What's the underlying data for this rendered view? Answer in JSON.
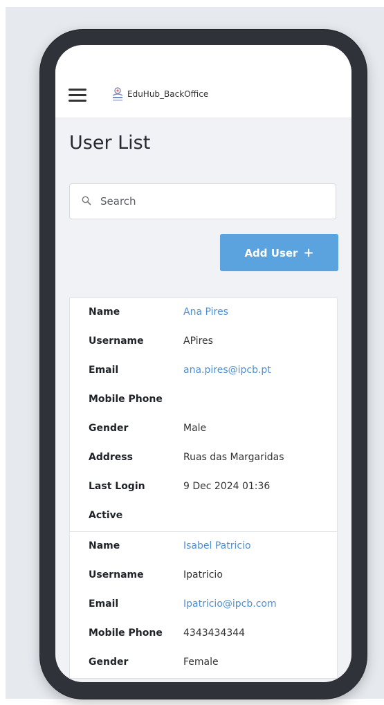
{
  "navbar": {
    "brand": "EduHub_BackOffice"
  },
  "page": {
    "title": "User List"
  },
  "search": {
    "placeholder": "Search"
  },
  "actions": {
    "add_user_label": "Add User",
    "add_user_icon": "+"
  },
  "fields": {
    "name": "Name",
    "username": "Username",
    "email": "Email",
    "mobile_phone": "Mobile Phone",
    "gender": "Gender",
    "address": "Address",
    "last_login": "Last Login",
    "active": "Active"
  },
  "users": [
    {
      "name": "Ana Pires",
      "username": "APires",
      "email": "ana.pires@ipcb.pt",
      "mobile_phone": "",
      "gender": "Male",
      "address": "Ruas das Margaridas",
      "last_login": "9 Dec 2024 01:36",
      "active": ""
    },
    {
      "name": "Isabel Patricio",
      "username": "Ipatricio",
      "email": "Ipatricio@ipcb.com",
      "mobile_phone": "4343434344",
      "gender": "Female"
    }
  ],
  "colors": {
    "accent": "#5aa3de",
    "link": "#4f8fd0"
  }
}
